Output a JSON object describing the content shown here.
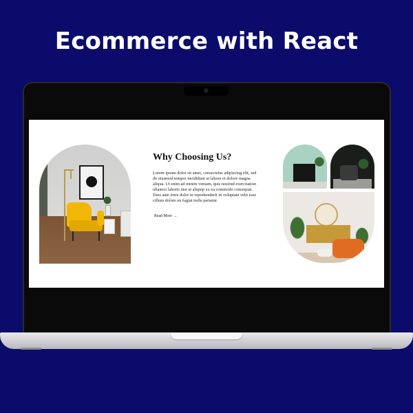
{
  "promo": {
    "title": "Ecommerce with React"
  },
  "section": {
    "heading": "Why Choosing Us?",
    "body": "Lorem ipsum dolor sit amet, consectetur adipiscing elit, sed do eiusmod tempor incididunt ut labore et dolore magna aliqua. Ut enim ad minim veniam, quis nostrud exercitation ullamco laboris nisi ut aliquip ex ea commodo consequat. Duis aute irure dolor in reprehenderit in voluptate velit esse cillum dolore eu fugiat nulla pariatur.",
    "read_more_label": "Read More",
    "read_more_arrow": "→"
  },
  "colors": {
    "background": "#0b0b6b",
    "accent_chair": "#f2b705",
    "accent_sofa": "#e06c24",
    "teal": "#a9d2c2"
  },
  "icons": {
    "read_more": "arrow-right-icon"
  }
}
